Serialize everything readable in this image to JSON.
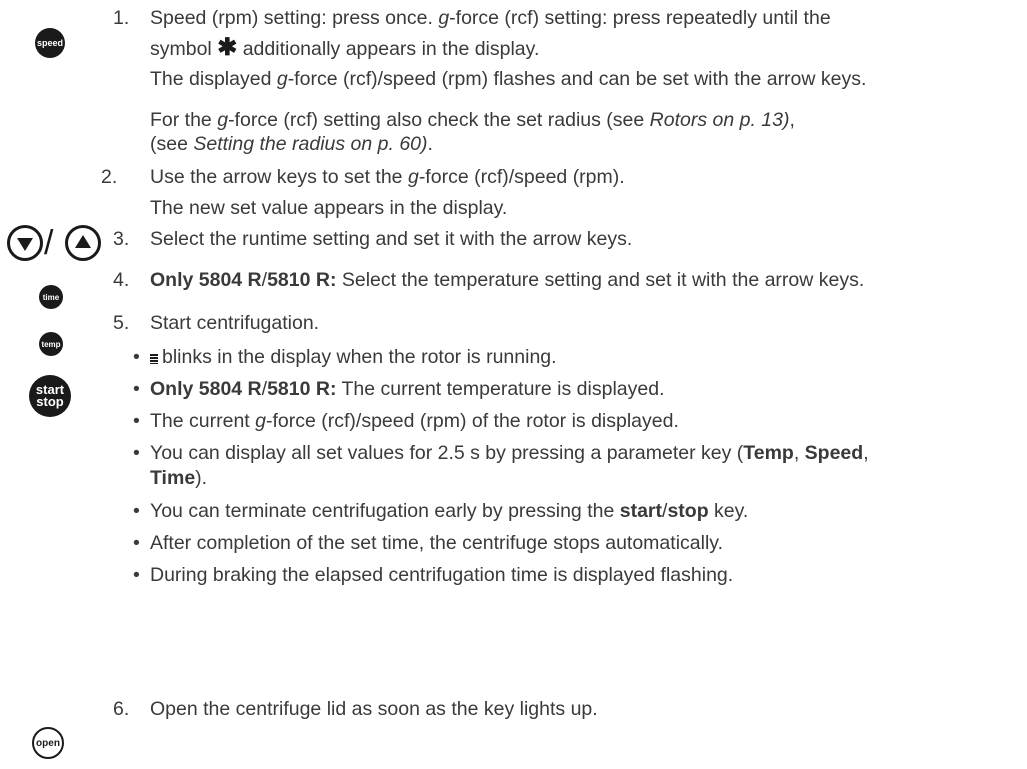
{
  "keys": {
    "speed": "speed",
    "arrow_down": "down arrow key",
    "arrow_up": "up arrow key",
    "arrow_slash": "/",
    "time": "time",
    "temp": "temp",
    "start": "start",
    "stop": "stop",
    "open": "open"
  },
  "steps": {
    "s1": {
      "num": "1.",
      "a1": "Speed (rpm) setting: press once. ",
      "a2": "g",
      "a3": "-force (rcf) setting: press repeatedly until the",
      "b1": "symbol ",
      "b_symbol": "✱",
      "b2": " additionally appears in the display.",
      "c1": "The displayed ",
      "c2": "g",
      "c3": "-force (rcf)/speed (rpm) flashes and can be set with the arrow keys.",
      "d1": "For the ",
      "d2": "g",
      "d3": "-force (rcf) setting also check the set radius (see ",
      "d4": "Rotors on p. 13)",
      "d5": ",",
      "e1": "(see ",
      "e2": "Setting the radius on p. 60)",
      "e3": "."
    },
    "s2": {
      "num": "2.",
      "a1": "Use the arrow keys to set the ",
      "a2": "g",
      "a3": "-force (rcf)/speed (rpm).",
      "b": "The new set value appears in the display."
    },
    "s3": {
      "num": "3.",
      "text": " Select the runtime setting and set it with the arrow keys."
    },
    "s4": {
      "num": "4.",
      "bold": "Only 5804 R",
      "slash": "/",
      "bold2": "5810 R:",
      "rest": " Select the temperature setting and set it with the arrow keys."
    },
    "s5": {
      "num": "5.",
      "text": "Start centrifugation.",
      "bullet": "•",
      "b1": "blinks in the display when the rotor is running.",
      "b2_bold": "Only 5804 R",
      "b2_slash": "/",
      "b2_bold2": "5810 R:",
      "b2_rest": " The current temperature is displayed.",
      "b3_1": "The current ",
      "b3_2": "g",
      "b3_3": "-force (rcf)/speed (rpm) of the rotor is displayed.",
      "b4_1": "You can display all set values for 2.5 s by pressing a parameter key (",
      "b4_temp": "Temp",
      "b4_c1": ", ",
      "b4_speed": "Speed",
      "b4_c2": ",",
      "b4_time": "Time",
      "b4_end": ").",
      "b5_1": "You can terminate centrifugation early by pressing the ",
      "b5_start": "start",
      "b5_slash": "/",
      "b5_stop": "stop",
      "b5_end": " key.",
      "b6": "After completion of the set time, the centrifuge stops automatically.",
      "b7": "During braking the elapsed centrifugation time is displayed flashing."
    },
    "s6": {
      "num": "6.",
      "text": "Open the centrifuge lid as soon as the key lights up."
    }
  }
}
